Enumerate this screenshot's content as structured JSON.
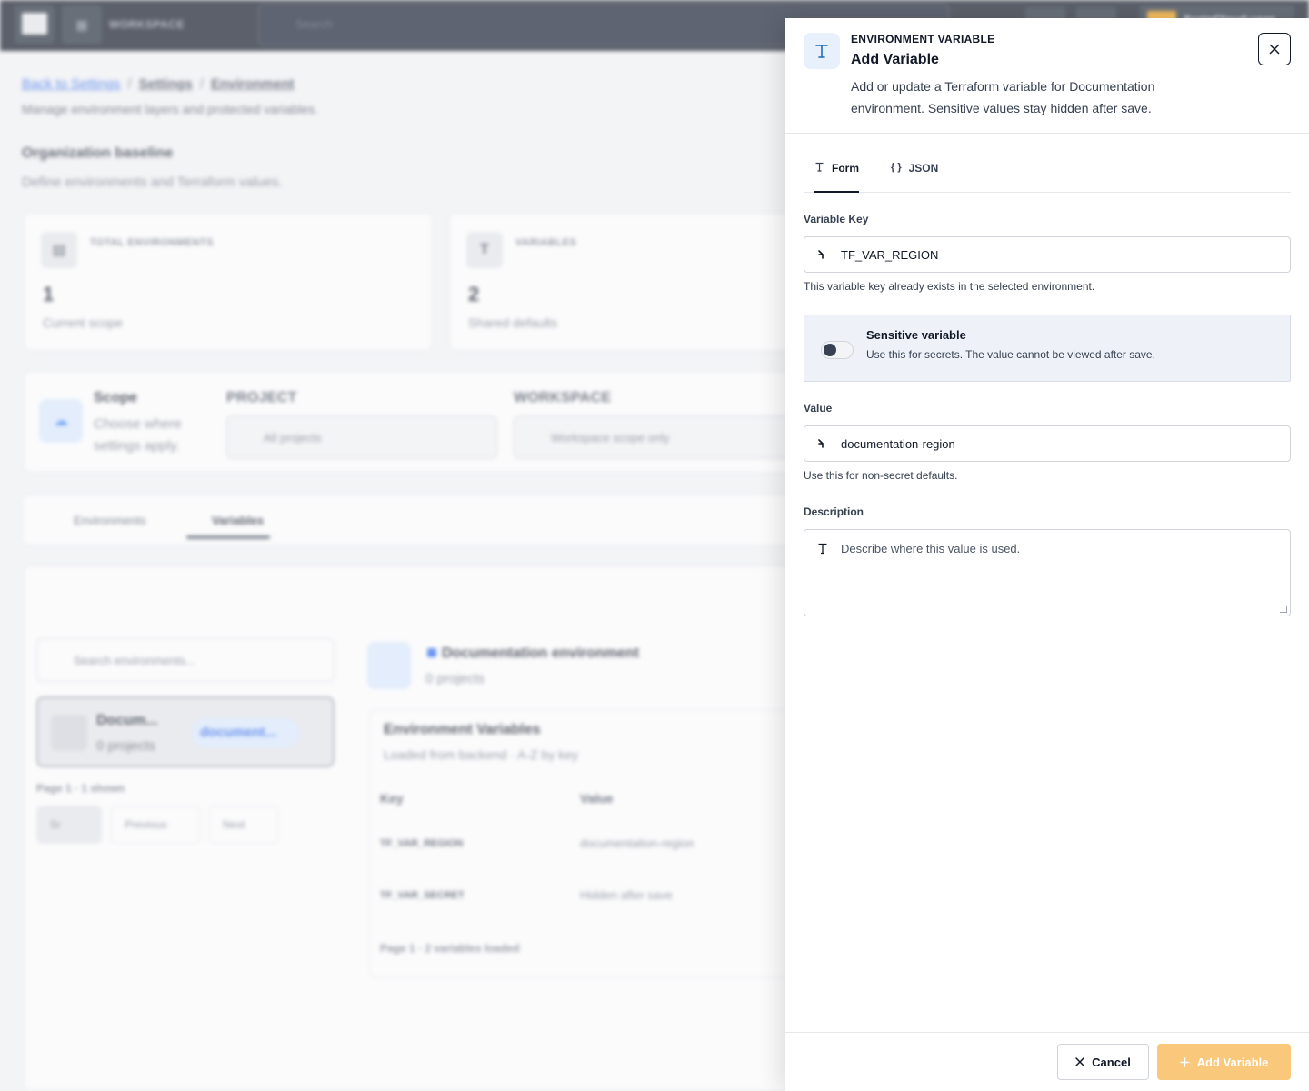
{
  "colors": {
    "accent": "#f59e0b",
    "add_button": "#f9c87a",
    "topbar": "#0b1220",
    "info_blue": "#1e6bb8"
  },
  "topbar": {
    "workspace_label": "WORKSPACE",
    "search_placeholder": "Search",
    "user_name": "ScripCloud user"
  },
  "background": {
    "breadcrumb": {
      "back": "Back to Settings",
      "settings": "Settings",
      "current": "Environment"
    },
    "subtitle": "Manage environment layers and protected variables.",
    "section_title": "Organization baseline",
    "section_subtitle": "Define environments and Terraform values.",
    "stats": [
      {
        "label": "TOTAL ENVIRONMENTS",
        "value": "1",
        "sub": "Current scope"
      },
      {
        "label": "VARIABLES",
        "value": "2",
        "sub": "Shared defaults"
      }
    ],
    "scope": {
      "title": "Scope",
      "subtitle": "Choose where settings apply.",
      "project_label": "PROJECT",
      "project_value": "All projects",
      "workspace_label": "WORKSPACE",
      "workspace_value": "Workspace scope only"
    },
    "tabs": {
      "environments": "Environments",
      "variables": "Variables"
    },
    "env_search_placeholder": "Search environments...",
    "env_item": {
      "name": "Docum...",
      "projects": "0 projects",
      "pill": "document..."
    },
    "pagination": {
      "label": "Page 1 · 1 shown",
      "sort": "Sr",
      "previous": "Previous",
      "next": "Next"
    },
    "detail": {
      "name": "Documentation environment",
      "projects": "0 projects",
      "table_title": "Environment Variables",
      "table_sub": "Loaded from backend · A-Z by key",
      "col_key": "Key",
      "col_value": "Value",
      "rows": [
        {
          "key": "TF_VAR_REGION",
          "value": "documentation-region"
        },
        {
          "key": "TF_VAR_SECRET",
          "value": "Hidden after save"
        }
      ],
      "footer": "Page 1 · 2 variables loaded"
    }
  },
  "drawer": {
    "eyebrow": "ENVIRONMENT VARIABLE",
    "title": "Add Variable",
    "description": "Add or update a Terraform variable for Documentation environment. Sensitive values stay hidden after save.",
    "tabs": [
      {
        "label": "Form",
        "active": true
      },
      {
        "label": "JSON",
        "active": false
      }
    ],
    "key_label": "Variable Key",
    "key_value": "TF_VAR_REGION",
    "key_help": "This variable key already exists in the selected environment.",
    "sensitive": {
      "title": "Sensitive variable",
      "subtitle": "Use this for secrets. The value cannot be viewed after save.",
      "enabled": false
    },
    "value_label": "Value",
    "value_value": "documentation-region",
    "value_help": "Use this for non-secret defaults.",
    "description_label": "Description",
    "description_placeholder": "Describe where this value is used.",
    "cancel_label": "Cancel",
    "submit_label": "Add Variable"
  }
}
